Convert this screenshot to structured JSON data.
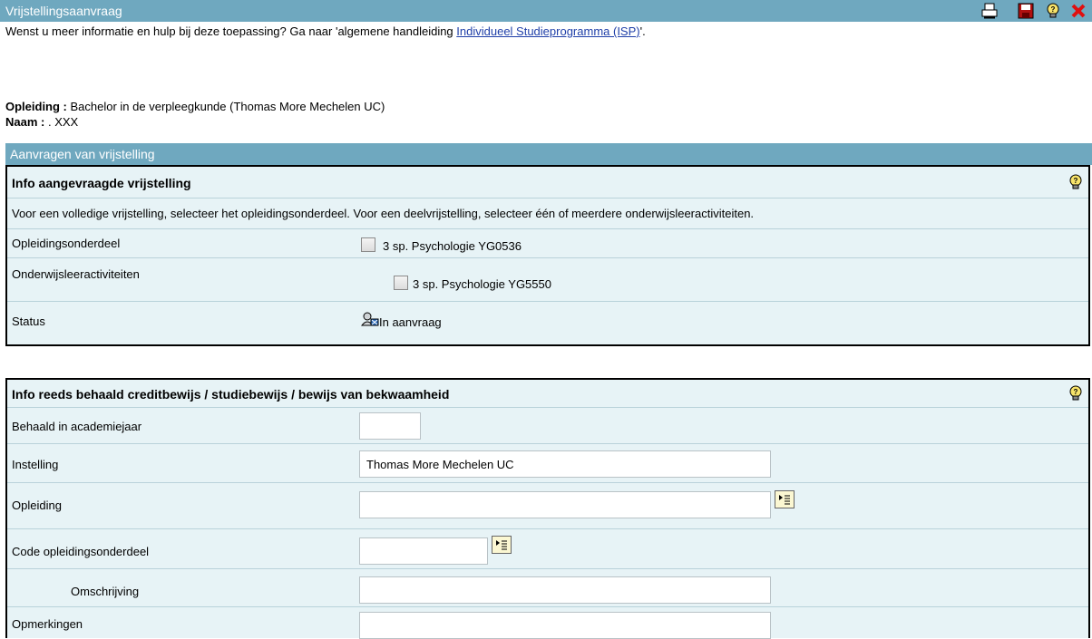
{
  "window": {
    "title": "Vrijstellingsaanvraag"
  },
  "toolbar": {
    "print_icon": "printer-icon",
    "save_icon": "floppy-save-icon",
    "help_icon": "lightbulb-help-icon",
    "close_icon": "close-x-icon"
  },
  "help": {
    "prefix": "Wenst u meer informatie en hulp bij deze toepassing? Ga naar 'algemene handleiding ",
    "link": "Individueel Studieprogramma (ISP)",
    "suffix": "'."
  },
  "meta": {
    "opleiding_label": "Opleiding :",
    "opleiding_value": " Bachelor in de verpleegkunde (Thomas More Mechelen UC)",
    "naam_label": "Naam :",
    "naam_value": ". XXX"
  },
  "section": {
    "title": "Aanvragen van vrijstelling"
  },
  "request_panel": {
    "title": "Info aangevraagde vrijstelling",
    "instruction": "Voor een volledige vrijstelling, selecteer het opleidingsonderdeel. Voor een deelvrijstelling, selecteer één of meerdere onderwijsleeractiviteiten.",
    "rows": {
      "opleidingsonderdeel_label": "Opleidingsonderdeel",
      "opleidingsonderdeel_value": "3 sp. Psychologie YG0536",
      "ola_label": "Onderwijsleeractiviteiten",
      "ola_value": "3 sp. Psychologie YG5550",
      "status_label": "Status",
      "status_value": "In aanvraag"
    },
    "status_icon": "user-pending-icon"
  },
  "credit_panel": {
    "title": "Info reeds behaald creditbewijs / studiebewijs / bewijs van bekwaamheid",
    "fields": {
      "academiejaar_label": "Behaald in academiejaar",
      "academiejaar_value": "",
      "instelling_label": "Instelling",
      "instelling_value": "Thomas More Mechelen UC",
      "opleiding_label": "Opleiding",
      "opleiding_value": "",
      "code_label": "Code opleidingsonderdeel",
      "code_value": "",
      "omschrijving_label": "Omschrijving",
      "omschrijving_value": "",
      "opmerkingen_label": "Opmerkingen",
      "opmerkingen_value": ""
    },
    "picker_icon": "list-picker-icon"
  },
  "colors": {
    "header_bg": "#6fa8bf",
    "panel_bg": "#e7f3f6",
    "link": "#1f3fa8",
    "close": "#e01010",
    "save": "#b01010"
  }
}
